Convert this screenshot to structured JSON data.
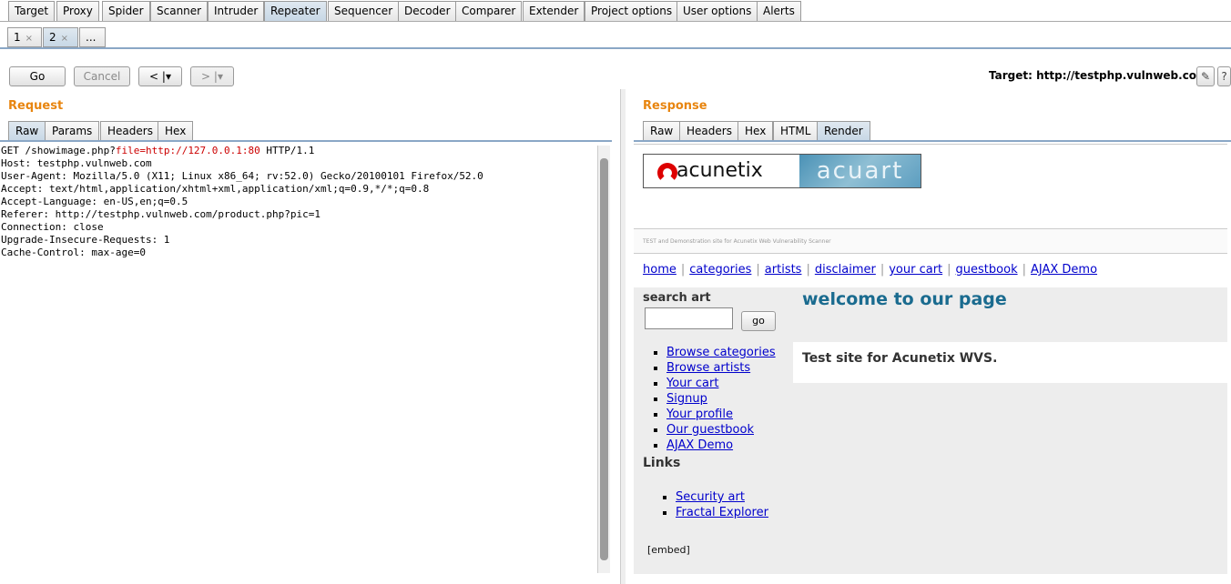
{
  "main_tabs": [
    "Target",
    "Proxy",
    "Spider",
    "Scanner",
    "Intruder",
    "Repeater",
    "Sequencer",
    "Decoder",
    "Comparer",
    "Extender",
    "Project options",
    "User options",
    "Alerts"
  ],
  "active_main_tab": "Repeater",
  "repeater_tabs": [
    {
      "label": "1",
      "close": "×"
    },
    {
      "label": "2",
      "close": "×"
    },
    {
      "label": "..."
    }
  ],
  "toolbar": {
    "go": "Go",
    "cancel": "Cancel",
    "back": "< |▾",
    "forward": "> |▾",
    "target_label": "Target: http://testphp.vulnweb.com"
  },
  "request": {
    "title": "Request",
    "tabs": [
      "Raw",
      "Params",
      "Headers",
      "Hex"
    ],
    "active_tab": "Raw",
    "line1_pre": "GET /showimage.php?",
    "line1_param": "file=http://127.0.0.1:80",
    "line1_post": " HTTP/1.1",
    "lines": [
      "Host: testphp.vulnweb.com",
      "User-Agent: Mozilla/5.0 (X11; Linux x86_64; rv:52.0) Gecko/20100101 Firefox/52.0",
      "Accept: text/html,application/xhtml+xml,application/xml;q=0.9,*/*;q=0.8",
      "Accept-Language: en-US,en;q=0.5",
      "Referer: http://testphp.vulnweb.com/product.php?pic=1",
      "Connection: close",
      "Upgrade-Insecure-Requests: 1",
      "Cache-Control: max-age=0"
    ]
  },
  "response": {
    "title": "Response",
    "tabs": [
      "Raw",
      "Headers",
      "Hex",
      "HTML",
      "Render"
    ],
    "active_tab": "Render",
    "render": {
      "logo_left": "acunetix",
      "logo_right": "acuart",
      "strip_text": "TEST and Demonstration site for Acunetix Web Vulnerability Scanner",
      "nav": [
        "home",
        "categories",
        "artists",
        "disclaimer",
        "your cart",
        "guestbook",
        "AJAX Demo"
      ],
      "search_label": "search art",
      "go_button": "go",
      "welcome": "welcome to our page",
      "test_site": "Test site for Acunetix WVS.",
      "menu": [
        "Browse categories",
        "Browse artists",
        "Your cart",
        "Signup",
        "Your profile",
        "Our guestbook",
        "AJAX Demo"
      ],
      "links_header": "Links",
      "links": [
        "Security art",
        "Fractal Explorer"
      ],
      "embed": "[embed]"
    }
  }
}
